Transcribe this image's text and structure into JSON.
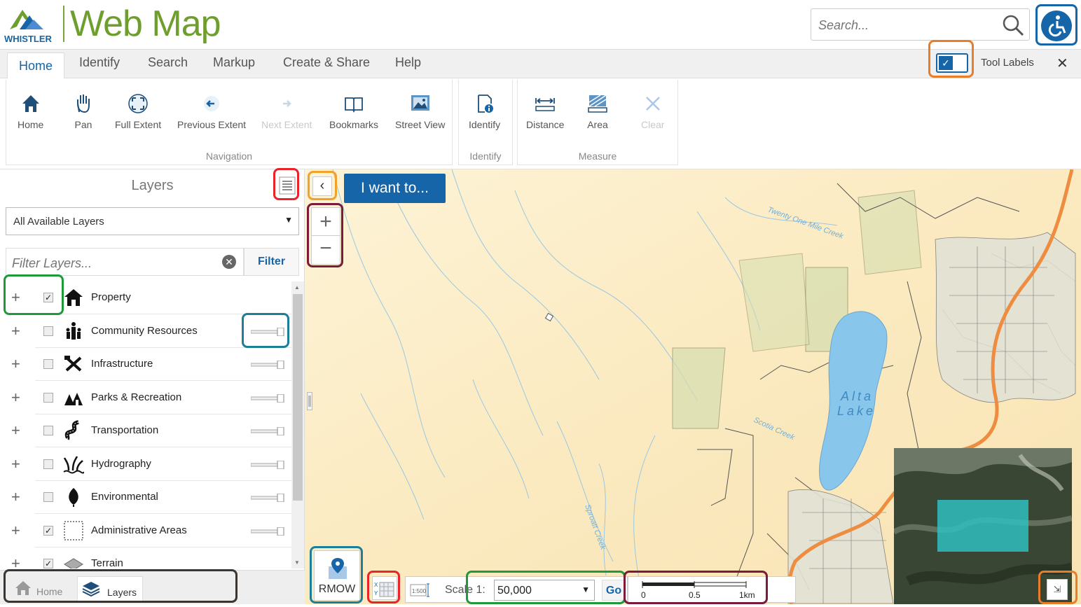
{
  "app": {
    "title": "Web Map",
    "logo_text": "WHISTLER"
  },
  "search": {
    "placeholder": "Search..."
  },
  "ribbon": {
    "tabs": [
      {
        "label": "Home",
        "active": true
      },
      {
        "label": "Identify"
      },
      {
        "label": "Search"
      },
      {
        "label": "Markup"
      },
      {
        "label": "Create & Share"
      },
      {
        "label": "Help"
      }
    ],
    "tool_labels_toggle": {
      "label": "Tool Labels",
      "checked": true
    },
    "close_symbol": "✕",
    "groups": {
      "navigation": {
        "label": "Navigation",
        "tools": [
          "Home",
          "Pan",
          "Full Extent",
          "Previous Extent",
          "Next Extent",
          "Bookmarks",
          "Street View"
        ]
      },
      "identify": {
        "label": "Identify",
        "tools": [
          "Identify"
        ]
      },
      "measure": {
        "label": "Measure",
        "tools": [
          "Distance",
          "Area",
          "Clear"
        ]
      }
    }
  },
  "left_panel": {
    "title": "Layers",
    "layer_filter_select": "All Available Layers",
    "filter_placeholder": "Filter Layers...",
    "filter_button": "Filter",
    "layers": [
      {
        "name": "Property",
        "checked": true,
        "icon": "house-icon"
      },
      {
        "name": "Community Resources",
        "checked": false,
        "icon": "people-icon"
      },
      {
        "name": "Infrastructure",
        "checked": false,
        "icon": "tools-icon"
      },
      {
        "name": "Parks & Recreation",
        "checked": false,
        "icon": "tents-icon"
      },
      {
        "name": "Transportation",
        "checked": false,
        "icon": "road-icon"
      },
      {
        "name": "Hydrography",
        "checked": false,
        "icon": "water-plants-icon"
      },
      {
        "name": "Environmental",
        "checked": false,
        "icon": "leaf-icon"
      },
      {
        "name": "Administrative Areas",
        "checked": true,
        "icon": "dashed-box-icon"
      },
      {
        "name": "Terrain",
        "checked": true,
        "icon": "terrain-icon"
      }
    ],
    "bottom_tabs": [
      "Home",
      "Layers"
    ]
  },
  "map": {
    "i_want_to": "I want to...",
    "labels": {
      "lake": "Alta Lake",
      "creek1": "Twenty One Mile Creek",
      "creek2": "Sproatt Creek",
      "creek3": "Scotia Creek"
    },
    "rmow_label": "RMOW",
    "scale": {
      "label": "Scale 1:",
      "value": "50,000",
      "go": "Go",
      "icon_text": "1:500"
    },
    "scalebar_ticks": [
      "0",
      "0.5",
      "1km"
    ]
  },
  "colors": {
    "brand_green": "#6e9f2e",
    "accent_blue": "#1565a8"
  }
}
